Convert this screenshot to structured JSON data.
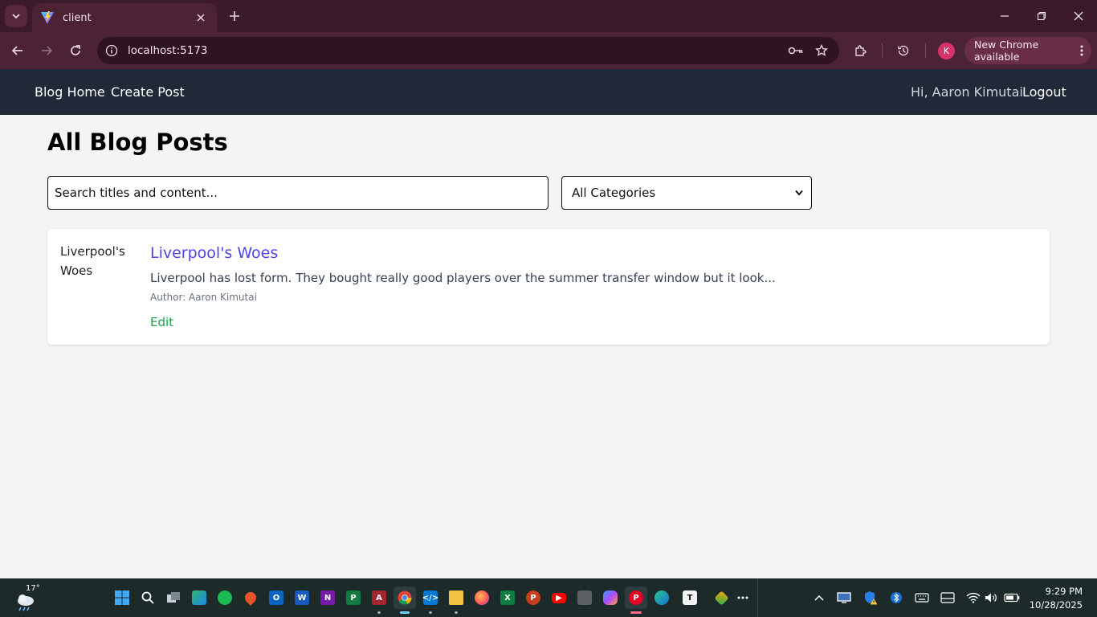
{
  "browser": {
    "tab_title": "client",
    "url": "localhost:5173",
    "profile_initial": "K",
    "update_label": "New Chrome available",
    "colors": {
      "frame": "#3b1a2a",
      "toolbar": "#4c2235",
      "profile": "#d6336c"
    }
  },
  "app": {
    "nav": {
      "home": "Blog Home",
      "create": "Create Post",
      "greeting": "Hi, Aaron Kimutai",
      "logout": "Logout"
    },
    "page_title": "All Blog Posts",
    "search": {
      "placeholder": "Search titles and content..."
    },
    "category": {
      "selected": "All Categories"
    },
    "posts": [
      {
        "image_alt": "Liverpool's Woes",
        "title": "Liverpool's Woes",
        "excerpt": "Liverpool has lost form. They bought really good players over the summer transfer window but it look...",
        "author": "Author: Aaron Kimutai",
        "edit_label": "Edit"
      }
    ],
    "colors": {
      "nav_bg": "#1f2937",
      "title_link": "#4f46e5",
      "edit_link": "#16a34a"
    }
  },
  "taskbar": {
    "weather_temp": "17°",
    "time": "9:29 PM",
    "date": "10/28/2025"
  }
}
